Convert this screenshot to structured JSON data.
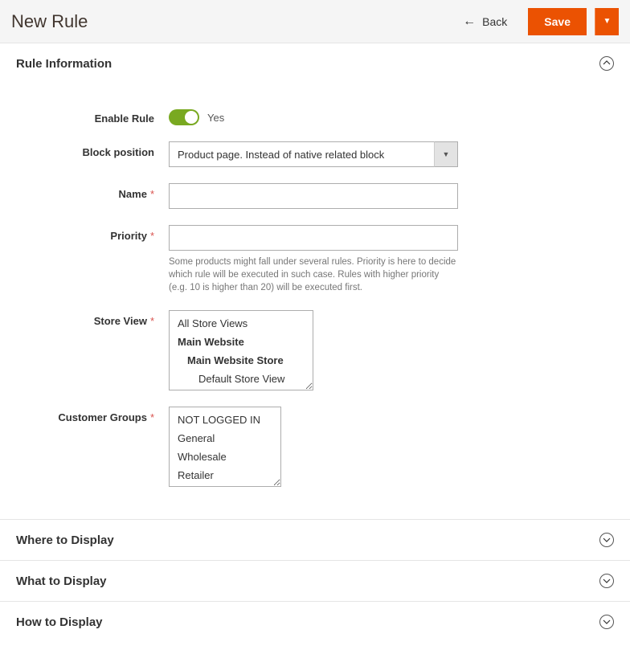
{
  "header": {
    "title": "New Rule",
    "back_label": "Back",
    "save_label": "Save"
  },
  "sections": {
    "rule_info": "Rule Information",
    "where": "Where to Display",
    "what": "What to Display",
    "how": "How to Display"
  },
  "form": {
    "enable": {
      "label": "Enable Rule",
      "value_label": "Yes"
    },
    "block_position": {
      "label": "Block position",
      "selected": "Product page. Instead of native related block"
    },
    "name": {
      "label": "Name",
      "value": ""
    },
    "priority": {
      "label": "Priority",
      "value": "",
      "help": "Some products might fall under several rules. Priority is here to decide which rule will be executed in such case. Rules with higher priority (e.g. 10 is higher than 20) will be executed first."
    },
    "store_view": {
      "label": "Store View",
      "options": [
        {
          "text": "All Store Views",
          "bold": false,
          "indent": 0
        },
        {
          "text": "Main Website",
          "bold": true,
          "indent": 0
        },
        {
          "text": "Main Website Store",
          "bold": true,
          "indent": 1
        },
        {
          "text": "Default Store View",
          "bold": false,
          "indent": 2
        }
      ]
    },
    "customer_groups": {
      "label": "Customer Groups",
      "options": [
        {
          "text": "NOT LOGGED IN"
        },
        {
          "text": "General"
        },
        {
          "text": "Wholesale"
        },
        {
          "text": "Retailer"
        }
      ]
    }
  }
}
